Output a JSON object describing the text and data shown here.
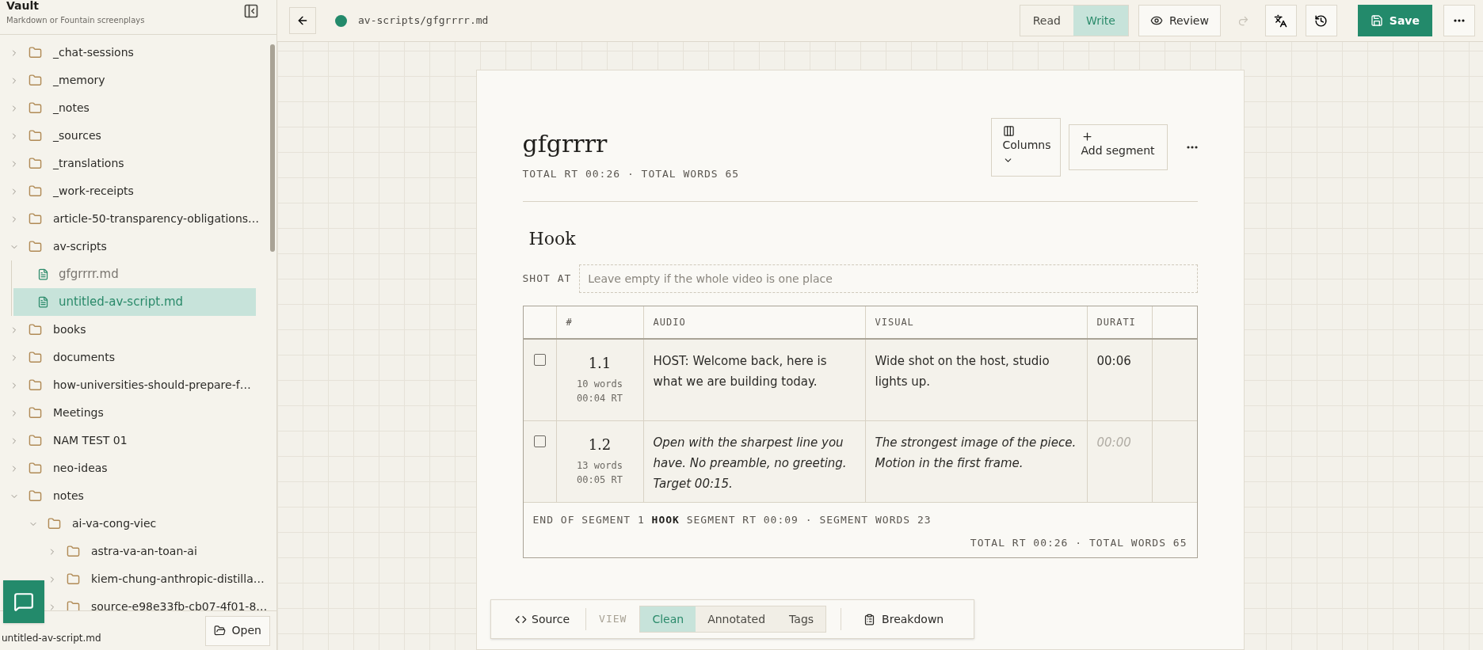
{
  "sidebar": {
    "title": "Vault",
    "subtitle": "Markdown or Fountain screenplays",
    "tree": [
      {
        "kind": "folder",
        "label": "_chat-sessions",
        "expanded": false,
        "selected": false
      },
      {
        "kind": "folder",
        "label": "_memory",
        "expanded": false,
        "selected": false
      },
      {
        "kind": "folder",
        "label": "_notes",
        "expanded": false,
        "selected": false
      },
      {
        "kind": "folder",
        "label": "_sources",
        "expanded": false,
        "selected": false
      },
      {
        "kind": "folder",
        "label": "_translations",
        "expanded": false,
        "selected": false
      },
      {
        "kind": "folder",
        "label": "_work-receipts",
        "expanded": false,
        "selected": false
      },
      {
        "kind": "folder",
        "label": "article-50-transparency-obligations…",
        "expanded": false,
        "selected": false
      },
      {
        "kind": "folder",
        "label": "av-scripts",
        "expanded": true,
        "selected": false,
        "children": [
          {
            "kind": "file",
            "label": "gfgrrrr.md",
            "selected": false
          },
          {
            "kind": "file",
            "label": "untitled-av-script.md",
            "selected": true
          }
        ]
      },
      {
        "kind": "folder",
        "label": "books",
        "expanded": false,
        "selected": false
      },
      {
        "kind": "folder",
        "label": "documents",
        "expanded": false,
        "selected": false
      },
      {
        "kind": "folder",
        "label": "how-universities-should-prepare-f…",
        "expanded": false,
        "selected": false
      },
      {
        "kind": "folder",
        "label": "Meetings",
        "expanded": false,
        "selected": false
      },
      {
        "kind": "folder",
        "label": "NAM TEST 01",
        "expanded": false,
        "selected": false
      },
      {
        "kind": "folder",
        "label": "neo-ideas",
        "expanded": false,
        "selected": false
      },
      {
        "kind": "folder",
        "label": "notes",
        "expanded": true,
        "selected": false,
        "children": [
          {
            "kind": "folder",
            "label": "ai-va-cong-viec",
            "expanded": true,
            "selected": false,
            "children": [
              {
                "kind": "folder",
                "label": "astra-va-an-toan-ai",
                "expanded": false,
                "selected": false
              },
              {
                "kind": "folder",
                "label": "kiem-chung-anthropic-distilla…",
                "expanded": false,
                "selected": false
              },
              {
                "kind": "folder",
                "label": "source-e98e33fb-cb07-4f01-8…",
                "expanded": false,
                "selected": false
              }
            ]
          }
        ]
      }
    ],
    "footer_file": "untitled-av-script.md",
    "open_button": "Open"
  },
  "topbar": {
    "path": "av-scripts/gfgrrrr.md",
    "modes": [
      {
        "label": "Read",
        "selected": false
      },
      {
        "label": "Write",
        "selected": true
      }
    ],
    "review": "Review",
    "redo_disabled": true,
    "save": "Save"
  },
  "document": {
    "title": "gfgrrrr",
    "stats": "TOTAL RT 00:26 · TOTAL WORDS 65",
    "columns_button": "Columns",
    "add_segment": "Add segment",
    "segments": [
      {
        "heading": "Hook",
        "shot_label": "SHOT AT",
        "shot_placeholder": "Leave empty if the whole video is one place",
        "columns": [
          "#",
          "AUDIO",
          "VISUAL",
          "DURATI"
        ],
        "rows": [
          {
            "kind": "filled",
            "checked": false,
            "number": "1.1",
            "words": "10 words",
            "rt": "00:04 RT",
            "audio": "HOST: Welcome back, here is what we are building today.",
            "visual": "Wide shot on the host, studio lights up.",
            "duration": "00:06"
          },
          {
            "kind": "template",
            "checked": false,
            "number": "1.2",
            "words": "13 words",
            "rt": "00:05 RT",
            "audio": "Open with the sharpest line you have. No preamble, no greeting. Target 00:15.",
            "visual": "The strongest image of the piece. Motion in the first frame.",
            "duration": "00:00"
          }
        ],
        "footer": "END OF SEGMENT 1 **HOOK** SEGMENT RT 00:09 · SEGMENT WORDS 23",
        "totals": "TOTAL RT 00:26 · TOTAL WORDS 65"
      }
    ]
  },
  "bottom_bar": {
    "source": "Source",
    "view_label": "VIEW",
    "views": [
      {
        "label": "Clean",
        "selected": true
      },
      {
        "label": "Annotated",
        "selected": false
      },
      {
        "label": "Tags",
        "selected": false
      }
    ],
    "breakdown": "Breakdown"
  }
}
